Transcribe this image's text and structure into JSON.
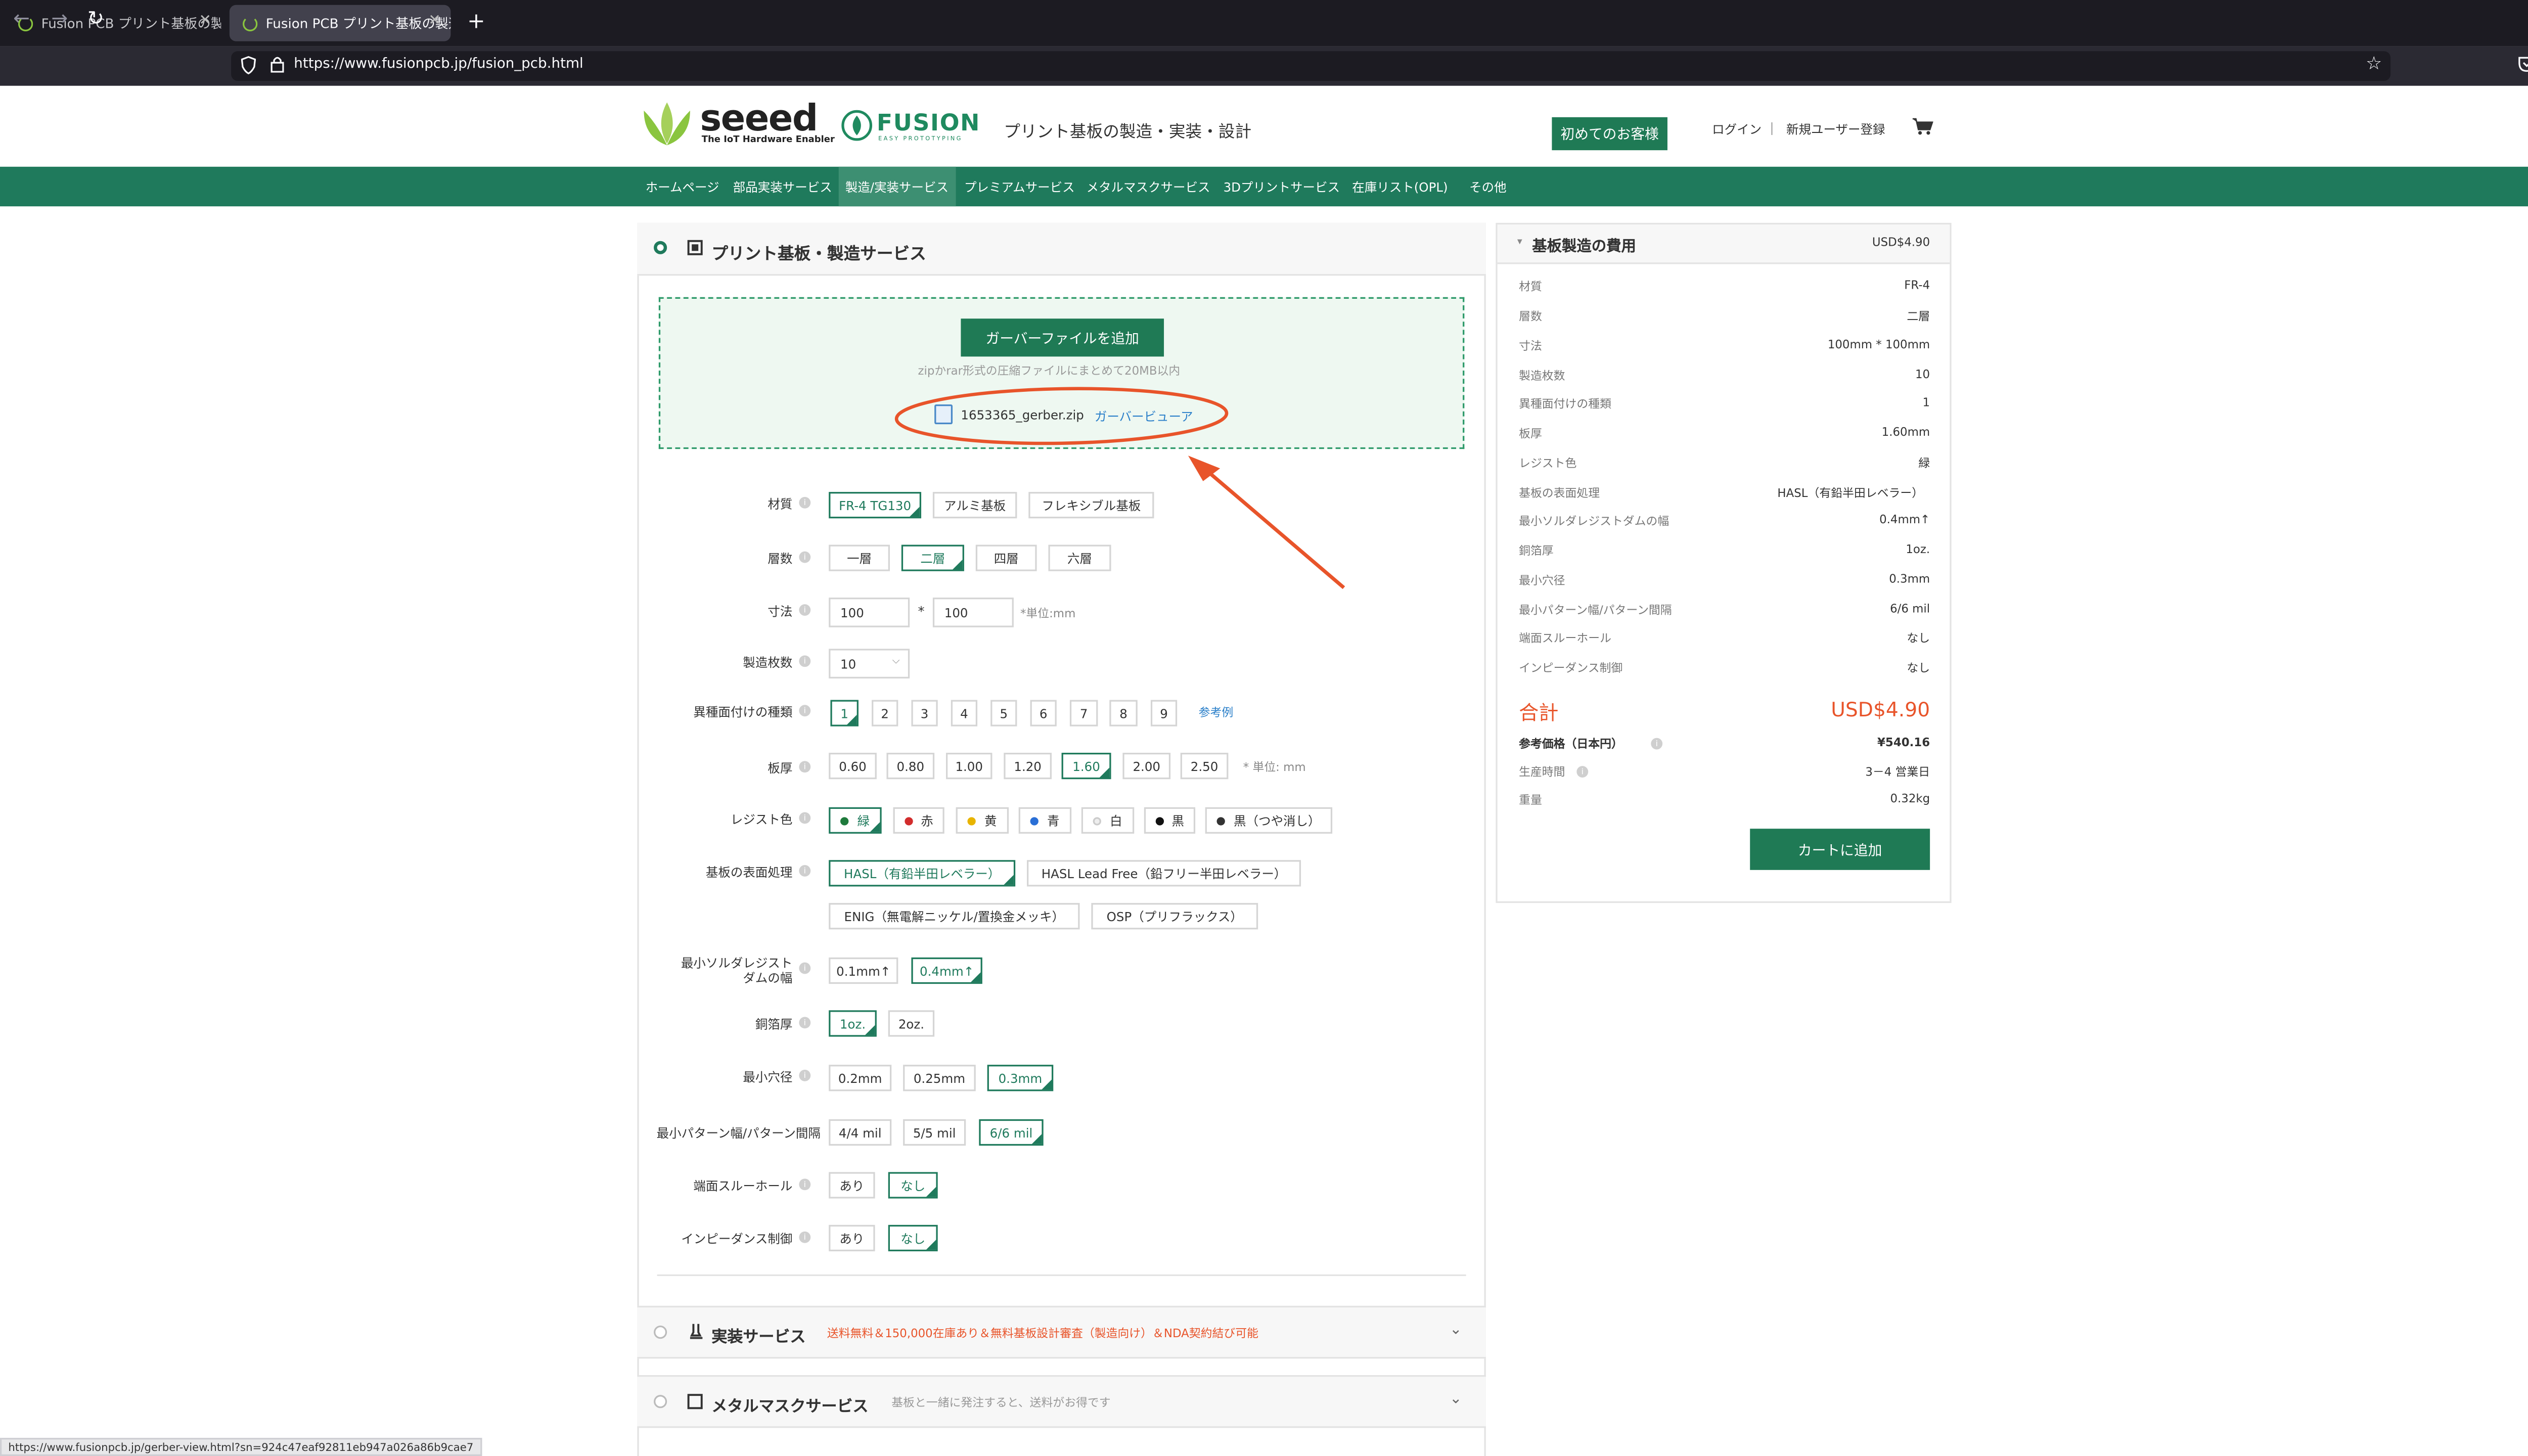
{
  "browser": {
    "tabs": [
      {
        "title": "Fusion PCB プリント基板の製造・実装・設計"
      },
      {
        "title": "Fusion PCB プリント基板の製造・実装・設計"
      }
    ],
    "url": "https://www.fusionpcb.jp/fusion_pcb.html",
    "status_url": "https://www.fusionpcb.jp/gerber-view.html?sn=924c47eaf92811eb947a026a86b9cae7"
  },
  "header": {
    "seeed": "seeed",
    "seeed_tagline": "The IoT Hardware Enabler",
    "fusion": "FUSION",
    "fusion_sub": "EASY PROTOTYPING",
    "tagline": "プリント基板の製造・実装・設計",
    "first_visit": "初めてのお客様",
    "login": "ログイン",
    "separator": "|",
    "register": "新規ユーザー登録"
  },
  "nav": [
    "ホームページ",
    "部品実装サービス",
    "製造/実装サービス",
    "プレミアムサービス",
    "メタルマスクサービス",
    "3Dプリントサービス",
    "在庫リスト(OPL)",
    "その他"
  ],
  "pcb": {
    "section_title": "プリント基板・製造サービス",
    "upload_button": "ガーバーファイルを追加",
    "upload_hint": "zipかrar形式の圧縮ファイルにまとめて20MB以内",
    "file_name": "1653365_gerber.zip",
    "viewer_link": "ガーバービューア",
    "labels": {
      "material": "材質",
      "layers": "層数",
      "size": "寸法",
      "quantity": "製造枚数",
      "designs": "異種面付けの種類",
      "thickness": "板厚",
      "color": "レジスト色",
      "finish": "基板の表面処理",
      "min_mask": "最小ソルダレジスト",
      "min_mask2": "ダムの幅",
      "copper": "銅箔厚",
      "min_hole": "最小穴径",
      "min_trace": "最小パターン幅/パターン間隔",
      "castellated": "端面スルーホール",
      "impedance": "インピーダンス制御"
    },
    "material_opts": [
      "FR-4 TG130",
      "アルミ基板",
      "フレキシブル基板"
    ],
    "layer_opts": [
      "一層",
      "二層",
      "四層",
      "六層"
    ],
    "size_w": "100",
    "size_h": "100",
    "size_times": "*",
    "size_unit": "*単位:mm",
    "quantity": "10",
    "design_opts": [
      "1",
      "2",
      "3",
      "4",
      "5",
      "6",
      "7",
      "8",
      "9"
    ],
    "design_ref": "参考例",
    "thickness_opts": [
      "0.60",
      "0.80",
      "1.00",
      "1.20",
      "1.60",
      "2.00",
      "2.50"
    ],
    "thickness_unit": "* 単位: mm",
    "color_opts": [
      {
        "label": "緑",
        "color": "#1f7a3c"
      },
      {
        "label": "赤",
        "color": "#d22c2c"
      },
      {
        "label": "黄",
        "color": "#e8b400"
      },
      {
        "label": "青",
        "color": "#2a6fd6"
      },
      {
        "label": "白",
        "color": "#eeeeee"
      },
      {
        "label": "黒",
        "color": "#111111"
      },
      {
        "label": "黒（つや消し）",
        "color": "#333333"
      }
    ],
    "finish_opts": [
      "HASL（有鉛半田レベラー）",
      "HASL Lead Free（鉛フリー半田レベラー）",
      "ENIG（無電解ニッケル/置換金メッキ）",
      "OSP（プリフラックス）"
    ],
    "mask_opts": [
      "0.1mm↑",
      "0.4mm↑"
    ],
    "copper_opts": [
      "1oz.",
      "2oz."
    ],
    "hole_opts": [
      "0.2mm",
      "0.25mm",
      "0.3mm"
    ],
    "trace_opts": [
      "4/4 mil",
      "5/5 mil",
      "6/6 mil"
    ],
    "castellated_opts": [
      "あり",
      "なし"
    ],
    "impedance_opts": [
      "あり",
      "なし"
    ]
  },
  "assembly": {
    "title": "実装サービス",
    "note": "送料無料＆150,000在庫あり＆無料基板設計審査（製造向け）＆NDA契約結び可能",
    "note_color": "#e8542a"
  },
  "stencil": {
    "title": "メタルマスクサービス",
    "note": "基板と一緒に発注すると、送料がお得です",
    "note_color": "#999999"
  },
  "summary": {
    "title": "基板製造の費用",
    "header_price": "USD$4.90",
    "rows": [
      {
        "label": "材質",
        "value": "FR-4"
      },
      {
        "label": "層数",
        "value": "二層"
      },
      {
        "label": "寸法",
        "value": "100mm * 100mm"
      },
      {
        "label": "製造枚数",
        "value": "10"
      },
      {
        "label": "異種面付けの種類",
        "value": "1"
      },
      {
        "label": "板厚",
        "value": "1.60mm"
      },
      {
        "label": "レジスト色",
        "value": "緑"
      },
      {
        "label": "基板の表面処理",
        "value": "HASL（有鉛半田レベラー）"
      },
      {
        "label": "最小ソルダレジストダムの幅",
        "value": "0.4mm↑"
      },
      {
        "label": "銅箔厚",
        "value": "1oz."
      },
      {
        "label": "最小穴径",
        "value": "0.3mm"
      },
      {
        "label": "最小パターン幅/パターン間隔",
        "value": "6/6 mil"
      },
      {
        "label": "端面スルーホール",
        "value": "なし"
      },
      {
        "label": "インピーダンス制御",
        "value": "なし"
      }
    ],
    "total_label": "合計",
    "total_value": "USD$4.90",
    "ref_label": "参考価格（日本円）",
    "ref_value": "¥540.16",
    "lead_label": "生産時間",
    "lead_value": "3－4 営業日",
    "weight_label": "重量",
    "weight_value": "0.32kg",
    "cart_button": "カートに追加"
  },
  "colors": {
    "brand_green": "#1f7a5c",
    "annotation_red": "#e8542a"
  }
}
